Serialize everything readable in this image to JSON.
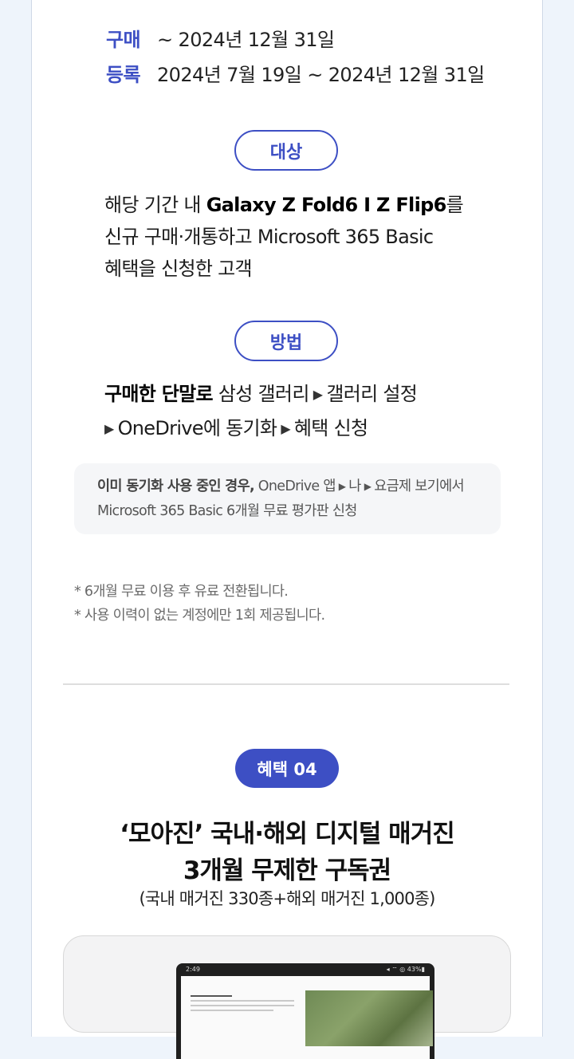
{
  "period": {
    "purchase_label": "구매",
    "purchase_value": "~ 2024년 12월 31일",
    "register_label": "등록",
    "register_value": "2024년 7월 19일 ~ 2024년 12월 31일"
  },
  "target": {
    "pill": "대상",
    "line1_pre": "해당 기간 내 ",
    "line1_bold": "Galaxy Z Fold6 I Z Flip6",
    "line1_post": "를",
    "line2": "신규 구매·개통하고 Microsoft 365 Basic",
    "line3": "혜택을 신청한 고객"
  },
  "method": {
    "pill": "방법",
    "line1_bold": "구매한 단말로",
    "line1_a": " 삼성 갤러리",
    "line1_b": "갤러리 설정",
    "line2_a": "OneDrive에 동기화",
    "line2_b": "혜택 신청",
    "arrow": "▶"
  },
  "note": {
    "bold": "이미 동기화 사용 중인 경우,",
    "part1": " OneDrive 앱",
    "part2": "나",
    "part3": "요금제 보기에서",
    "line2": "Microsoft 365 Basic 6개월 무료 평가판 신청"
  },
  "footnotes": [
    "* 6개월 무료 이용 후 유료 전환됩니다.",
    "* 사용 이력이 없는 계정에만 1회 제공됩니다."
  ],
  "benefit": {
    "badge": "혜택 04",
    "title_line1": "‘모아진’ 국내·해외 디지털 매거진",
    "title_line2": "3개월 무제한 구독권",
    "subtitle": "(국내 매거진 330종+해외 매거진 1,000종)"
  },
  "device": {
    "status_time": "2:49",
    "status_right": "◂ ⌔ ◎ 43%▮"
  },
  "colors": {
    "accent": "#3d4fc4",
    "background": "#eef4fb",
    "note_bg": "#f5f6f8"
  }
}
